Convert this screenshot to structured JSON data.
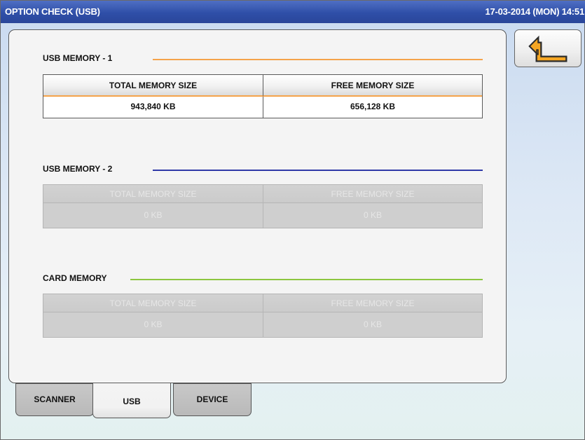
{
  "header": {
    "title": "OPTION CHECK (USB)",
    "datetime": "17-03-2014 (MON)  14:51"
  },
  "back_button": {
    "icon": "return-arrow-icon",
    "color": "#f0a020"
  },
  "sections": [
    {
      "title": "USB MEMORY - 1",
      "line_color": "#f5a34a",
      "enabled": true,
      "total_label": "TOTAL MEMORY SIZE",
      "free_label": "FREE MEMORY SIZE",
      "total_value": "943,840 KB",
      "free_value": "656,128 KB"
    },
    {
      "title": "USB MEMORY - 2",
      "line_color": "#2f3aa8",
      "enabled": false,
      "total_label": "TOTAL MEMORY SIZE",
      "free_label": "FREE MEMORY SIZE",
      "total_value": "0 KB",
      "free_value": "0 KB"
    },
    {
      "title": "CARD MEMORY",
      "line_color": "#8cc63f",
      "enabled": false,
      "total_label": "TOTAL MEMORY SIZE",
      "free_label": "FREE MEMORY SIZE",
      "total_value": "0 KB",
      "free_value": "0 KB"
    }
  ],
  "tabs": [
    {
      "label": "SCANNER",
      "active": false
    },
    {
      "label": "USB",
      "active": true
    },
    {
      "label": "DEVICE",
      "active": false
    }
  ]
}
